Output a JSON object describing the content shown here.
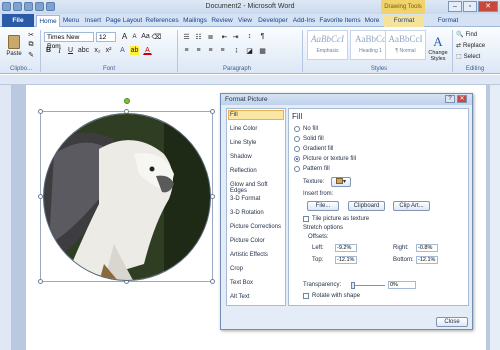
{
  "window": {
    "title": "Document2 - Microsoft Word",
    "context_tab_drawing": "Drawing Tools",
    "context_tab_picture": "Pi..."
  },
  "tabs": [
    "File",
    "Home",
    "Menu",
    "Insert",
    "Page Layout",
    "References",
    "Mailings",
    "Review",
    "View",
    "Developer",
    "Add-Ins",
    "Favorite Items",
    "More",
    "Format",
    "Format"
  ],
  "ribbon": {
    "paste": "Paste",
    "font_name": "Times New Rom",
    "font_size": "12",
    "styles": [
      {
        "sample": "AaBbCcI",
        "name": "Emphasis"
      },
      {
        "sample": "AaBbCc",
        "name": "Heading 1"
      },
      {
        "sample": "AaBbCcI",
        "name": "¶ Normal"
      }
    ],
    "change_styles": "Change Styles",
    "find": "Find",
    "replace": "Replace",
    "select": "Select",
    "groups": {
      "clipboard": "Clipbo...",
      "font": "Font",
      "paragraph": "Paragraph",
      "styles": "Styles",
      "editing": "Editing"
    }
  },
  "dialog": {
    "title": "Format Picture",
    "categories": [
      "Fill",
      "Line Color",
      "Line Style",
      "Shadow",
      "Reflection",
      "Glow and Soft Edges",
      "3-D Format",
      "3-D Rotation",
      "Picture Corrections",
      "Picture Color",
      "Artistic Effects",
      "Crop",
      "Text Box",
      "Alt Text"
    ],
    "selected_category": "Fill",
    "fill": {
      "heading": "Fill",
      "options": [
        "No fill",
        "Solid fill",
        "Gradient fill",
        "Picture or texture fill",
        "Pattern fill"
      ],
      "selected_option": "Picture or texture fill",
      "texture_label": "Texture:",
      "insert_from": "Insert from:",
      "file_btn": "File...",
      "clipboard_btn": "Clipboard",
      "clipart_btn": "Clip Art...",
      "tile_label": "Tile picture as texture",
      "stretch_options": "Stretch options",
      "offsets": "Offsets:",
      "left_label": "Left:",
      "left_val": "-9.2%",
      "right_label": "Right:",
      "right_val": "-0.8%",
      "top_label": "Top:",
      "top_val": "-12.1%",
      "bottom_label": "Bottom:",
      "bottom_val": "-12.1%",
      "transparency_label": "Transparency:",
      "transparency_val": "0%",
      "rotate_label": "Rotate with shape"
    },
    "close_btn": "Close"
  },
  "colors": {
    "accent": "#2a5aa8",
    "ribbon": "#dce7f5",
    "selection": "#fbe7a4"
  }
}
